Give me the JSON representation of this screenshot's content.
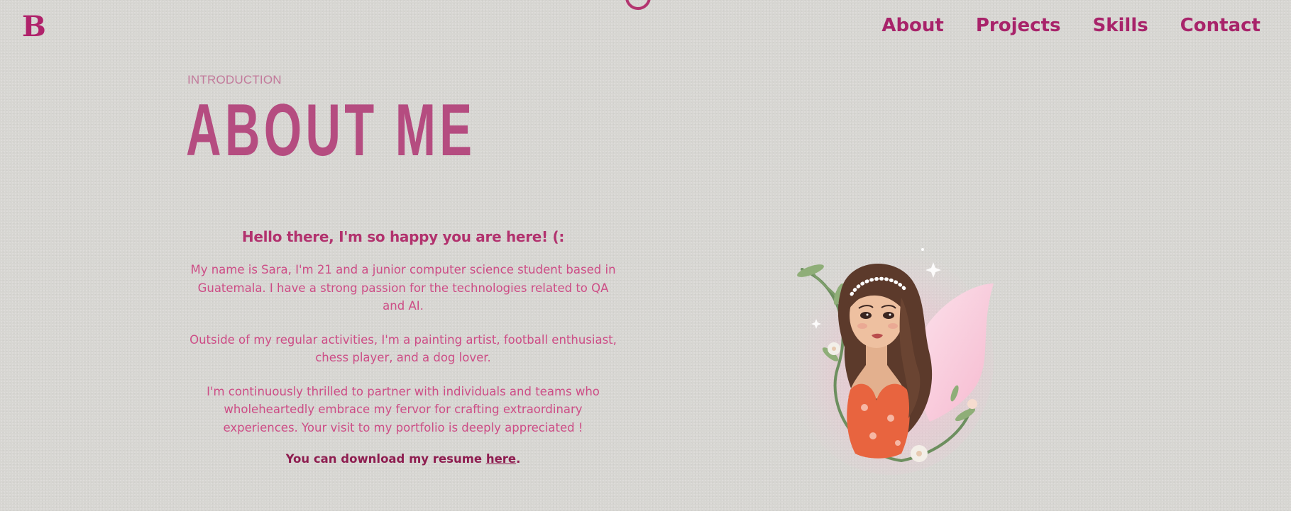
{
  "brand": {
    "logo_text": "B"
  },
  "nav": {
    "items": [
      {
        "label": "About"
      },
      {
        "label": "Projects"
      },
      {
        "label": "Skills"
      },
      {
        "label": "Contact"
      }
    ]
  },
  "intro": {
    "eyebrow": "INTRODUCTION",
    "title": "ABOUT ME"
  },
  "about": {
    "greeting": "Hello there, I'm so happy you are here! (:",
    "paragraphs": [
      "My name is Sara, I'm 21 and a junior computer science student based in Guatemala. I have a strong passion for the technologies related to QA and AI.",
      "Outside of my regular activities, I'm a painting artist, football enthusiast, chess player, and a dog lover.",
      "I'm continuously thrilled to partner with individuals and teams who wholeheartedly embrace my fervor for crafting extraordinary experiences. Your visit to my portfolio is deeply appreciated !"
    ],
    "resume_prefix": "You can download my resume ",
    "resume_link": "here",
    "resume_suffix": "."
  },
  "colors": {
    "background": "#d7d6d2",
    "accent": "#b0226b",
    "title": "#b54c80",
    "body_text": "#cd4d86",
    "resume_text": "#8e1d50"
  },
  "icons": {
    "logo": "b-monogram-logo",
    "top_decoration": "ring-icon",
    "portrait": "girl-avatar-illustration"
  }
}
